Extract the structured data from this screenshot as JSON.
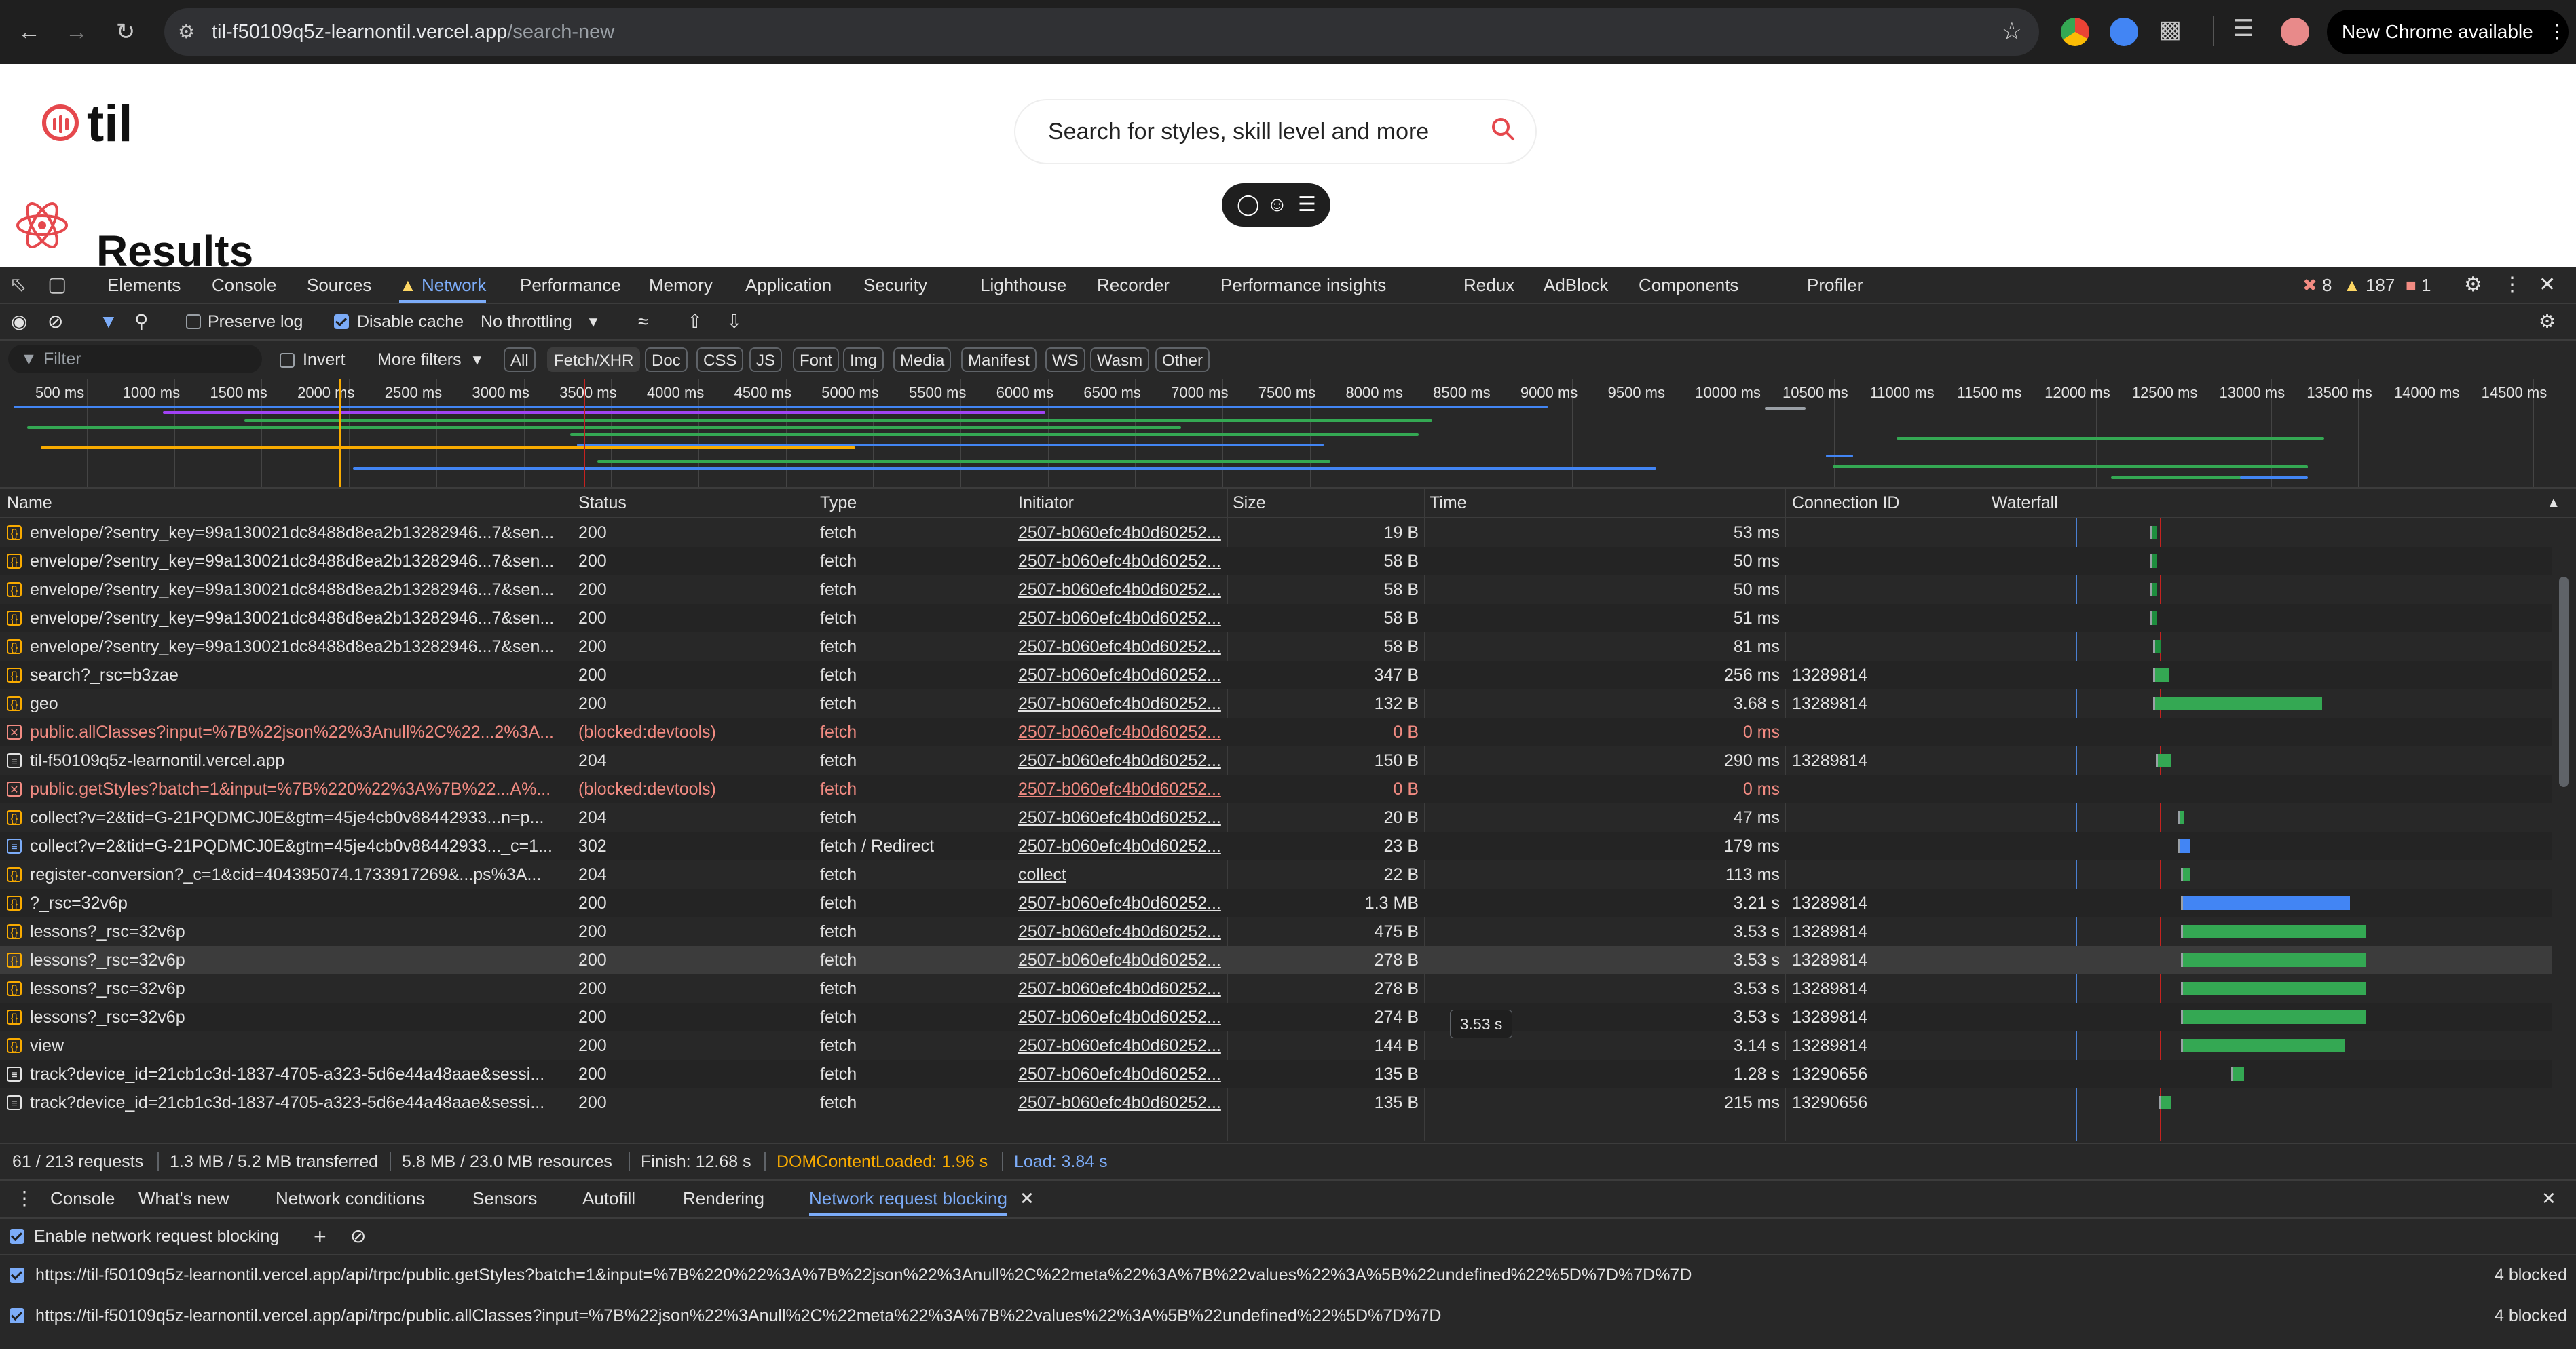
{
  "browser": {
    "url_host": "til-f50109q5z-learnontil.vercel.app",
    "url_path": "/search-new",
    "new_chrome_label": "New Chrome available"
  },
  "page": {
    "logo_text": "til",
    "search_placeholder": "Search for styles, skill level and more",
    "results_heading": "Results",
    "accent_color": "#e5484d"
  },
  "devtools": {
    "tabs": [
      "Elements",
      "Console",
      "Sources",
      "Network",
      "Performance",
      "Memory",
      "Application",
      "Security",
      "Lighthouse",
      "Recorder",
      "Performance insights",
      "Redux",
      "AdBlock",
      "Components",
      "Profiler"
    ],
    "active_tab": "Network",
    "counts": {
      "errors": "8",
      "warnings": "187",
      "issues": "1"
    },
    "toolbar": {
      "preserve_log": "Preserve log",
      "disable_cache": "Disable cache",
      "throttling": "No throttling"
    },
    "filter": {
      "placeholder": "Filter",
      "invert": "Invert",
      "more_filters": "More filters",
      "chips": [
        "All",
        "Fetch/XHR",
        "Doc",
        "CSS",
        "JS",
        "Font",
        "Img",
        "Media",
        "Manifest",
        "WS",
        "Wasm",
        "Other"
      ],
      "selected_chip": "Fetch/XHR"
    },
    "overview_ticks": [
      "500 ms",
      "1000 ms",
      "1500 ms",
      "2000 ms",
      "2500 ms",
      "3000 ms",
      "3500 ms",
      "4000 ms",
      "4500 ms",
      "5000 ms",
      "5500 ms",
      "6000 ms",
      "6500 ms",
      "7000 ms",
      "7500 ms",
      "8000 ms",
      "8500 ms",
      "9000 ms",
      "9500 ms",
      "10000 ms",
      "10500 ms",
      "11000 ms",
      "11500 ms",
      "12000 ms",
      "12500 ms",
      "13000 ms",
      "13500 ms",
      "14000 ms",
      "14500 ms"
    ],
    "columns": [
      "Name",
      "Status",
      "Type",
      "Initiator",
      "Size",
      "Time",
      "Connection ID",
      "Waterfall"
    ],
    "rows": [
      {
        "icon": "fetch",
        "name": "envelope/?sentry_key=99a130021dc8488d8ea2b13282946...7&sen...",
        "status": "200",
        "type": "fetch",
        "initiator": "2507-b060efc4b0d60252...",
        "size": "19 B",
        "time": "53 ms",
        "conn": "",
        "wf_start": 0.285,
        "wf_len": 0.008,
        "wf_color": "#1e8e3e"
      },
      {
        "icon": "fetch",
        "name": "envelope/?sentry_key=99a130021dc8488d8ea2b13282946...7&sen...",
        "status": "200",
        "type": "fetch",
        "initiator": "2507-b060efc4b0d60252...",
        "size": "58 B",
        "time": "50 ms",
        "conn": "",
        "wf_start": 0.285,
        "wf_len": 0.008,
        "wf_color": "#1e8e3e"
      },
      {
        "icon": "fetch",
        "name": "envelope/?sentry_key=99a130021dc8488d8ea2b13282946...7&sen...",
        "status": "200",
        "type": "fetch",
        "initiator": "2507-b060efc4b0d60252...",
        "size": "58 B",
        "time": "50 ms",
        "conn": "",
        "wf_start": 0.285,
        "wf_len": 0.008,
        "wf_color": "#1e8e3e"
      },
      {
        "icon": "fetch",
        "name": "envelope/?sentry_key=99a130021dc8488d8ea2b13282946...7&sen...",
        "status": "200",
        "type": "fetch",
        "initiator": "2507-b060efc4b0d60252...",
        "size": "58 B",
        "time": "51 ms",
        "conn": "",
        "wf_start": 0.285,
        "wf_len": 0.008,
        "wf_color": "#1e8e3e"
      },
      {
        "icon": "fetch",
        "name": "envelope/?sentry_key=99a130021dc8488d8ea2b13282946...7&sen...",
        "status": "200",
        "type": "fetch",
        "initiator": "2507-b060efc4b0d60252...",
        "size": "58 B",
        "time": "81 ms",
        "conn": "",
        "wf_start": 0.29,
        "wf_len": 0.01,
        "wf_color": "#1e8e3e"
      },
      {
        "icon": "fetch",
        "name": "search?_rsc=b3zae",
        "status": "200",
        "type": "fetch",
        "initiator": "2507-b060efc4b0d60252...",
        "size": "347 B",
        "time": "256 ms",
        "conn": "13289814",
        "wf_start": 0.29,
        "wf_len": 0.025,
        "wf_color": "#34a853"
      },
      {
        "icon": "fetch",
        "name": "geo",
        "status": "200",
        "type": "fetch",
        "initiator": "2507-b060efc4b0d60252...",
        "size": "132 B",
        "time": "3.68 s",
        "conn": "13289814",
        "wf_start": 0.29,
        "wf_len": 0.3,
        "wf_color": "#34a853"
      },
      {
        "icon": "error",
        "name": "public.allClasses?input=%7B%22json%22%3Anull%2C%22...2%3A...",
        "status": "(blocked:devtools)",
        "type": "fetch",
        "initiator": "2507-b060efc4b0d60252...",
        "size": "0 B",
        "time": "0 ms",
        "conn": "",
        "wf_start": 0,
        "wf_len": 0,
        "wf_color": "#34a853"
      },
      {
        "icon": "doc",
        "name": "til-f50109q5z-learnontil.vercel.app",
        "status": "204",
        "type": "fetch",
        "initiator": "2507-b060efc4b0d60252...",
        "size": "150 B",
        "time": "290 ms",
        "conn": "13289814",
        "wf_start": 0.295,
        "wf_len": 0.025,
        "wf_color": "#34a853"
      },
      {
        "icon": "error",
        "name": "public.getStyles?batch=1&input=%7B%220%22%3A%7B%22...A%...",
        "status": "(blocked:devtools)",
        "type": "fetch",
        "initiator": "2507-b060efc4b0d60252...",
        "size": "0 B",
        "time": "0 ms",
        "conn": "",
        "wf_start": 0,
        "wf_len": 0,
        "wf_color": "#34a853"
      },
      {
        "icon": "fetch",
        "name": "collect?v=2&tid=G-21PQDMCJ0E&gtm=45je4cb0v88442933...n=p...",
        "status": "204",
        "type": "fetch",
        "initiator": "2507-b060efc4b0d60252...",
        "size": "20 B",
        "time": "47 ms",
        "conn": "",
        "wf_start": 0.335,
        "wf_len": 0.008,
        "wf_color": "#34a853"
      },
      {
        "icon": "blue",
        "name": "collect?v=2&tid=G-21PQDMCJ0E&gtm=45je4cb0v88442933..._c=1...",
        "status": "302",
        "type": "fetch / Redirect",
        "initiator": "2507-b060efc4b0d60252...",
        "size": "23 B",
        "time": "179 ms",
        "conn": "",
        "wf_start": 0.335,
        "wf_len": 0.018,
        "wf_color": "#4285f4"
      },
      {
        "icon": "fetch",
        "name": "register-conversion?_c=1&cid=404395074.1733917269&...ps%3A...",
        "status": "204",
        "type": "fetch",
        "initiator": "collect",
        "size": "22 B",
        "time": "113 ms",
        "conn": "",
        "wf_start": 0.34,
        "wf_len": 0.012,
        "wf_color": "#34a853"
      },
      {
        "icon": "fetch",
        "name": "?_rsc=32v6p",
        "status": "200",
        "type": "fetch",
        "initiator": "2507-b060efc4b0d60252...",
        "size": "1.3 MB",
        "time": "3.21 s",
        "conn": "13289814",
        "wf_start": 0.34,
        "wf_len": 0.3,
        "wf_color": "#4285f4"
      },
      {
        "icon": "fetch",
        "name": "lessons?_rsc=32v6p",
        "status": "200",
        "type": "fetch",
        "initiator": "2507-b060efc4b0d60252...",
        "size": "475 B",
        "time": "3.53 s",
        "conn": "13289814",
        "wf_start": 0.34,
        "wf_len": 0.33,
        "wf_color": "#34a853"
      },
      {
        "icon": "fetch",
        "name": "lessons?_rsc=32v6p",
        "status": "200",
        "type": "fetch",
        "initiator": "2507-b060efc4b0d60252...",
        "size": "278 B",
        "time": "3.53 s",
        "conn": "13289814",
        "wf_start": 0.34,
        "wf_len": 0.33,
        "wf_color": "#34a853",
        "selected": true
      },
      {
        "icon": "fetch",
        "name": "lessons?_rsc=32v6p",
        "status": "200",
        "type": "fetch",
        "initiator": "2507-b060efc4b0d60252...",
        "size": "278 B",
        "time": "3.53 s",
        "conn": "13289814",
        "wf_start": 0.34,
        "wf_len": 0.33,
        "wf_color": "#34a853"
      },
      {
        "icon": "fetch",
        "name": "lessons?_rsc=32v6p",
        "status": "200",
        "type": "fetch",
        "initiator": "2507-b060efc4b0d60252...",
        "size": "274 B",
        "time": "3.53 s",
        "conn": "13289814",
        "wf_start": 0.34,
        "wf_len": 0.33,
        "wf_color": "#34a853"
      },
      {
        "icon": "fetch",
        "name": "view",
        "status": "200",
        "type": "fetch",
        "initiator": "2507-b060efc4b0d60252...",
        "size": "144 B",
        "time": "3.14 s",
        "conn": "13289814",
        "wf_start": 0.34,
        "wf_len": 0.29,
        "wf_color": "#34a853"
      },
      {
        "icon": "doc",
        "name": "track?device_id=21cb1c3d-1837-4705-a323-5d6e44a48aae&sessi...",
        "status": "200",
        "type": "fetch",
        "initiator": "2507-b060efc4b0d60252...",
        "size": "135 B",
        "time": "1.28 s",
        "conn": "13290656",
        "wf_start": 0.43,
        "wf_len": 0.02,
        "wf_color": "#34a853"
      },
      {
        "icon": "doc",
        "name": "track?device_id=21cb1c3d-1837-4705-a323-5d6e44a48aae&sessi...",
        "status": "200",
        "type": "fetch",
        "initiator": "2507-b060efc4b0d60252...",
        "size": "135 B",
        "time": "215 ms",
        "conn": "13290656",
        "wf_start": 0.3,
        "wf_len": 0.02,
        "wf_color": "#34a853"
      }
    ],
    "tooltip": "3.53 s",
    "summary": {
      "requests": "61 / 213 requests",
      "transferred": "1.3 MB / 5.2 MB transferred",
      "resources": "5.8 MB / 23.0 MB resources",
      "finish": "Finish: 12.68 s",
      "dcl": "DOMContentLoaded: 1.96 s",
      "load": "Load: 3.84 s"
    },
    "drawer": {
      "tabs": [
        "Console",
        "What's new",
        "Network conditions",
        "Sensors",
        "Autofill",
        "Rendering",
        "Network request blocking"
      ],
      "active_tab": "Network request blocking",
      "enable_label": "Enable network request blocking",
      "patterns": [
        {
          "url": "https://til-f50109q5z-learnontil.vercel.app/api/trpc/public.getStyles?batch=1&input=%7B%220%22%3A%7B%22json%22%3Anull%2C%22meta%22%3A%7B%22values%22%3A%5B%22undefined%22%5D%7D%7D%7D",
          "count": "4 blocked"
        },
        {
          "url": "https://til-f50109q5z-learnontil.vercel.app/api/trpc/public.allClasses?input=%7B%22json%22%3Anull%2C%22meta%22%3A%7B%22values%22%3A%5B%22undefined%22%5D%7D%7D",
          "count": "4 blocked"
        }
      ]
    }
  }
}
